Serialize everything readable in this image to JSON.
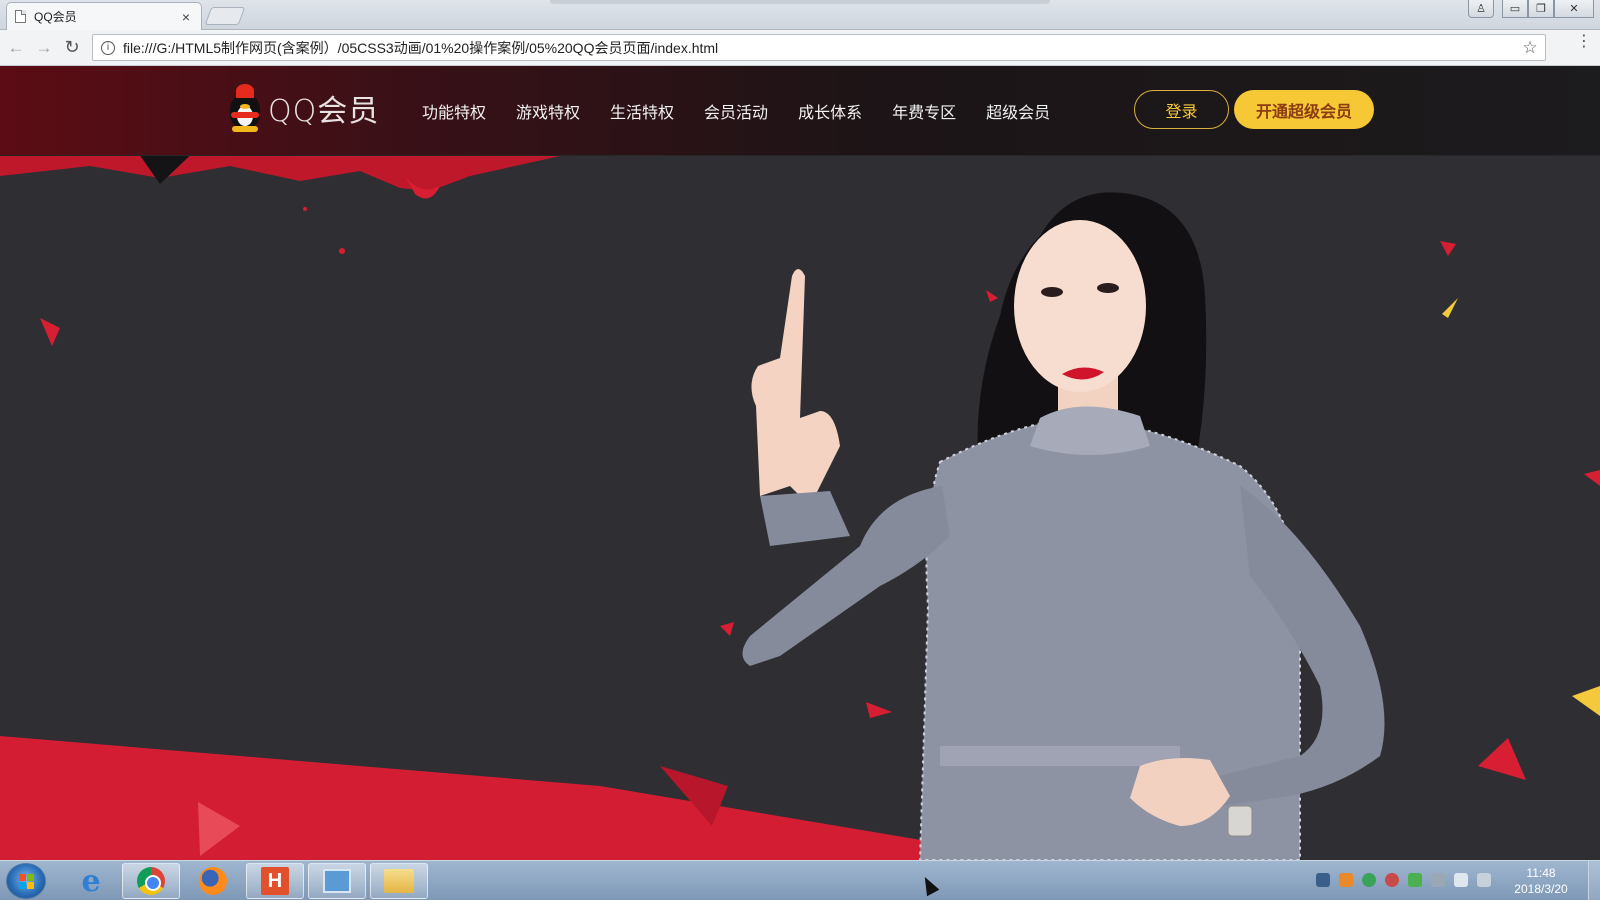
{
  "browser": {
    "tab_title": "QQ会员",
    "tab_close": "×",
    "url": "file:///G:/HTML5制作网页(含案例）/05CSS3动画/01%20操作案例/05%20QQ会员页面/index.html",
    "info_icon": "i",
    "star_icon": "☆",
    "menu_icon": "⋮",
    "back_icon": "←",
    "forward_icon": "→",
    "reload_icon": "↻"
  },
  "window_controls": {
    "user": "♙",
    "minimize": "▭",
    "maximize": "❐",
    "close": "✕"
  },
  "site": {
    "logo_text": "QQ会员",
    "nav": [
      "功能特权",
      "游戏特权",
      "生活特权",
      "会员活动",
      "成长体系",
      "年费专区",
      "超级会员"
    ],
    "login_label": "登录",
    "vip_label": "开通超级会员"
  },
  "colors": {
    "accent_red": "#d81e33",
    "accent_yellow": "#f7c835",
    "hero_dark": "#2f2e33"
  },
  "taskbar": {
    "apps": [
      "start-menu",
      "internet-explorer",
      "chrome",
      "firefox",
      "hbuilder",
      "remote-desktop",
      "file-explorer"
    ],
    "ie_glyph": "e",
    "hbuilder_glyph": "H",
    "clock_time": "11:48",
    "clock_date": "2018/3/20"
  }
}
